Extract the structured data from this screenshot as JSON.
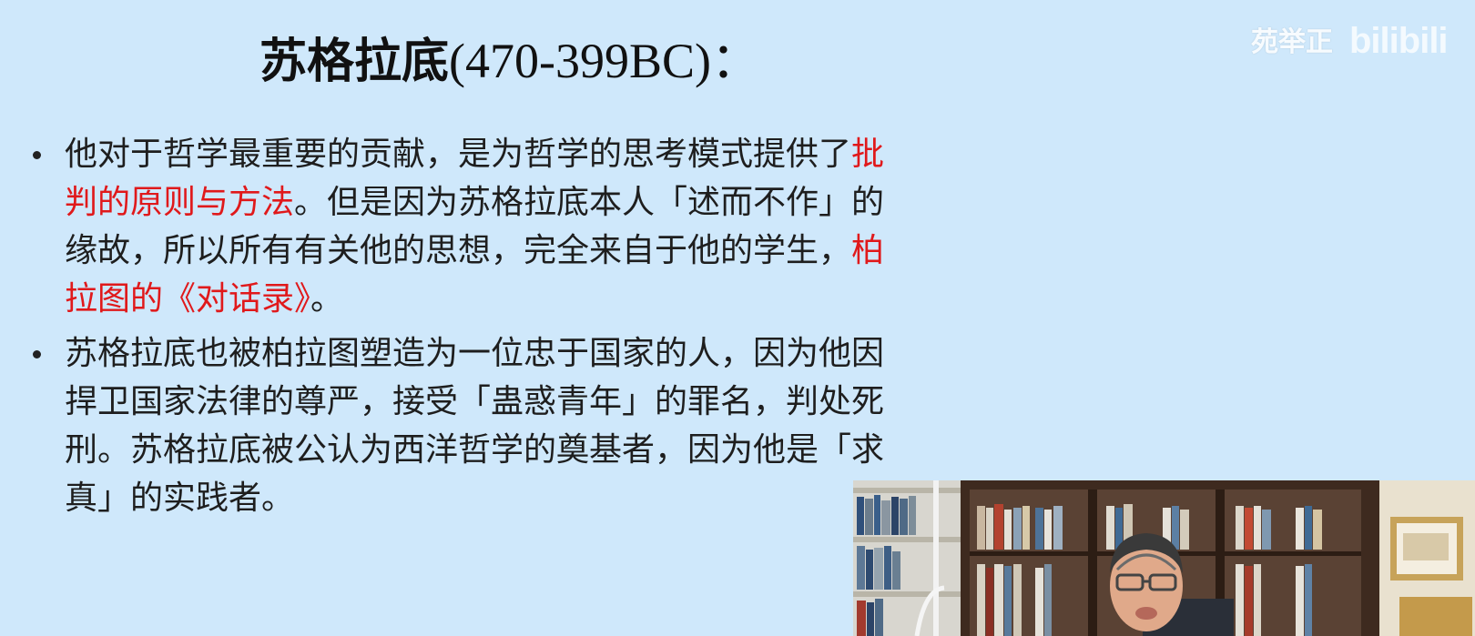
{
  "slide": {
    "title_cn": "苏格拉底",
    "title_years": "(470-399BC)：",
    "bullets": [
      {
        "lines": [
          [
            {
              "t": "他对于哲学最重要的贡献，是为哲学的思考模式提供了",
              "red": false
            },
            {
              "t": "批",
              "red": true
            }
          ],
          [
            {
              "t": "判的原则与方法",
              "red": true
            },
            {
              "t": "。但是因为苏格拉底本人「述而不作」的",
              "red": false
            }
          ],
          [
            {
              "t": "缘故，所以所有有关他的思想，完全来自于他的学生，",
              "red": false
            },
            {
              "t": "柏",
              "red": true
            }
          ],
          [
            {
              "t": "拉图的《对话录》",
              "red": true
            },
            {
              "t": "。",
              "red": false
            }
          ]
        ]
      },
      {
        "lines": [
          [
            {
              "t": "苏格拉底也被柏拉图塑造为一位忠于国家的人，因为他因",
              "red": false
            }
          ],
          [
            {
              "t": "捍卫国家法律的尊严，接受「蛊惑青年」的罪名，判处死",
              "red": false
            }
          ],
          [
            {
              "t": "刑。苏格拉底被公认为西洋哲学的奠基者，因为他是「求",
              "red": false
            }
          ],
          [
            {
              "t": "真」的实践者。",
              "red": false
            }
          ]
        ]
      }
    ]
  },
  "watermark": {
    "author": "苑举正",
    "logo_text": "bilibili"
  },
  "colors": {
    "background": "#cfe8fb",
    "text": "#1e1e1e",
    "highlight": "#e0191b"
  }
}
